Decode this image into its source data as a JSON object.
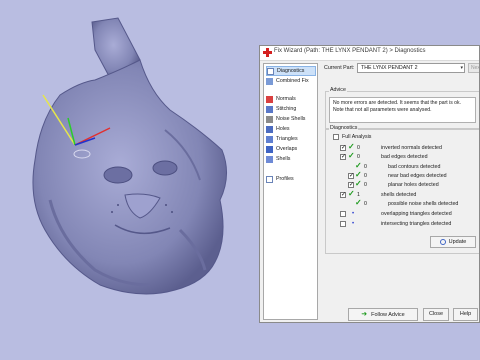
{
  "window": {
    "title": "Fix Wizard (Path: THE LYNX PENDANT 2) > Diagnostics"
  },
  "sidebar": {
    "items": [
      {
        "label": "Diagnostics",
        "icon": "diagnostics-icon"
      },
      {
        "label": "Combined Fix",
        "icon": "combined-fix-icon"
      },
      {
        "label": "Normals",
        "icon": "normals-icon"
      },
      {
        "label": "Stitching",
        "icon": "stitching-icon"
      },
      {
        "label": "Noise Shells",
        "icon": "noise-shells-icon"
      },
      {
        "label": "Holes",
        "icon": "holes-icon"
      },
      {
        "label": "Triangles",
        "icon": "triangles-icon"
      },
      {
        "label": "Overlaps",
        "icon": "overlaps-icon"
      },
      {
        "label": "Shells",
        "icon": "shells-icon"
      },
      {
        "label": "Profiles",
        "icon": "profiles-icon"
      }
    ]
  },
  "part": {
    "label": "Current Part:",
    "value": "THE LYNX PENDANT 2",
    "next_label": "Nex"
  },
  "advice": {
    "heading": "Advice",
    "text": "No more errors are detected. It seems that the part is ok. Note that not all parameters were analysed."
  },
  "diagnostics": {
    "heading": "Diagnostics",
    "full_analysis_label": "Full Analysis",
    "rows": [
      {
        "label": "inverted normals detected",
        "count": "0",
        "checked": true,
        "mark": "tick"
      },
      {
        "label": "bad edges detected",
        "count": "0",
        "checked": true,
        "mark": "tick"
      },
      {
        "label": "bad contours detected",
        "count": "0",
        "checked": false,
        "mark": "tick"
      },
      {
        "label": "near bad edges detected",
        "count": "0",
        "checked": true,
        "mark": "tick"
      },
      {
        "label": "planar holes detected",
        "count": "0",
        "checked": true,
        "mark": "tick"
      },
      {
        "label": "shells detected",
        "count": "1",
        "checked": true,
        "mark": "tick"
      },
      {
        "label": "possible noise shells detected",
        "count": "0",
        "checked": false,
        "mark": "tick"
      },
      {
        "label": "overlapping triangles detected",
        "count": "",
        "checked": false,
        "mark": "dot"
      },
      {
        "label": "intersecting triangles detected",
        "count": "",
        "checked": false,
        "mark": "dot"
      }
    ],
    "update_label": "Update"
  },
  "footer": {
    "follow_label": "Follow Advice",
    "close_label": "Close",
    "help_label": "Help"
  },
  "colors": {
    "viewport_bg": "#b9bde1",
    "model": "#8d90bf",
    "tick": "#1e9a1e",
    "dot": "#2a3fd0"
  }
}
